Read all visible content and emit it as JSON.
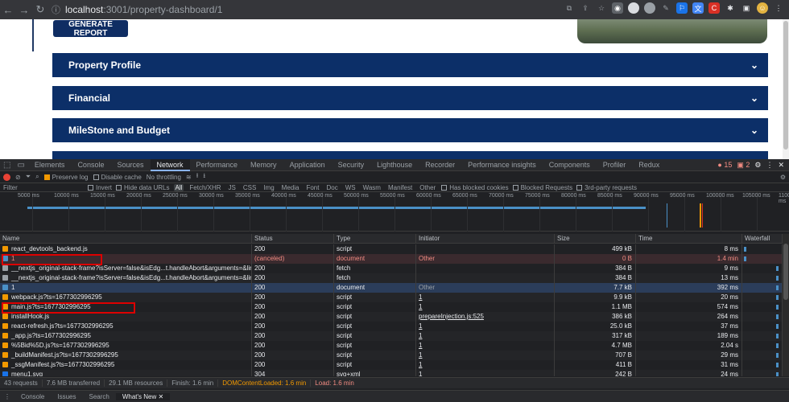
{
  "browser": {
    "url_host": "localhost",
    "url_path": ":3001/property-dashboard/1"
  },
  "page": {
    "generate_label": "GENERATE REPORT",
    "accordions": [
      {
        "label": "Property Profile"
      },
      {
        "label": "Financial"
      },
      {
        "label": "MileStone and Budget"
      }
    ]
  },
  "devtools": {
    "tabs": [
      "Elements",
      "Console",
      "Sources",
      "Network",
      "Performance",
      "Memory",
      "Application",
      "Security",
      "Lighthouse",
      "Recorder",
      "Performance insights",
      "Components",
      "Profiler",
      "Redux"
    ],
    "active_tab": "Network",
    "errors": "15",
    "warnings": "2",
    "toolbar": {
      "preserve_log": "Preserve log",
      "disable_cache": "Disable cache",
      "throttling": "No throttling"
    },
    "filter": {
      "placeholder": "Filter",
      "invert": "Invert",
      "hide_data_urls": "Hide data URLs",
      "types": [
        "All",
        "Fetch/XHR",
        "JS",
        "CSS",
        "Img",
        "Media",
        "Font",
        "Doc",
        "WS",
        "Wasm",
        "Manifest",
        "Other"
      ],
      "has_blocked_cookies": "Has blocked cookies",
      "blocked_requests": "Blocked Requests",
      "third_party": "3rd-party requests"
    },
    "timeline_ticks": [
      "5000 ms",
      "10000 ms",
      "15000 ms",
      "20000 ms",
      "25000 ms",
      "30000 ms",
      "35000 ms",
      "40000 ms",
      "45000 ms",
      "50000 ms",
      "55000 ms",
      "60000 ms",
      "65000 ms",
      "70000 ms",
      "75000 ms",
      "80000 ms",
      "85000 ms",
      "90000 ms",
      "95000 ms",
      "100000 ms",
      "105000 ms",
      "110000 ms"
    ],
    "columns": [
      "Name",
      "Status",
      "Type",
      "Initiator",
      "Size",
      "Time",
      "Waterfall"
    ],
    "rows": [
      {
        "name": "react_devtools_backend.js",
        "status": "200",
        "type": "script",
        "initiator": "",
        "size": "499 kB",
        "time": "8 ms",
        "kind": "script"
      },
      {
        "name": "1",
        "status": "(canceled)",
        "type": "document",
        "initiator": "Other",
        "size": "0 B",
        "time": "1.4 min",
        "kind": "doc",
        "canceled": true
      },
      {
        "name": "__nextjs_original-stack-frame?isServer=false&isEdg...t.handleAbort&arguments=&lineNumber=...",
        "status": "200",
        "type": "fetch",
        "initiator": "",
        "size": "384 B",
        "time": "9 ms",
        "kind": "fetch"
      },
      {
        "name": "__nextjs_original-stack-frame?isServer=false&isEdg...t.handleAbort&arguments=&lineNumber=...",
        "status": "200",
        "type": "fetch",
        "initiator": "",
        "size": "384 B",
        "time": "13 ms",
        "kind": "fetch"
      },
      {
        "name": "1",
        "status": "200",
        "type": "document",
        "initiator": "Other",
        "size": "7.7 kB",
        "time": "392 ms",
        "kind": "doc"
      },
      {
        "name": "webpack.js?ts=1677302996295",
        "status": "200",
        "type": "script",
        "initiator": "1",
        "size": "9.9 kB",
        "time": "20 ms",
        "kind": "script"
      },
      {
        "name": "main.js?ts=1677302996295",
        "status": "200",
        "type": "script",
        "initiator": "1",
        "size": "1.1 MB",
        "time": "574 ms",
        "kind": "script"
      },
      {
        "name": "installHook.js",
        "status": "200",
        "type": "script",
        "initiator": "prepareInjection.js:525",
        "size": "386 kB",
        "time": "264 ms",
        "kind": "script"
      },
      {
        "name": "react-refresh.js?ts=1677302996295",
        "status": "200",
        "type": "script",
        "initiator": "1",
        "size": "25.0 kB",
        "time": "37 ms",
        "kind": "script"
      },
      {
        "name": "_app.js?ts=1677302996295",
        "status": "200",
        "type": "script",
        "initiator": "1",
        "size": "317 kB",
        "time": "189 ms",
        "kind": "script"
      },
      {
        "name": "%5Bid%5D.js?ts=1677302996295",
        "status": "200",
        "type": "script",
        "initiator": "1",
        "size": "4.7 MB",
        "time": "2.04 s",
        "kind": "script"
      },
      {
        "name": "_buildManifest.js?ts=1677302996295",
        "status": "200",
        "type": "script",
        "initiator": "1",
        "size": "707 B",
        "time": "29 ms",
        "kind": "script"
      },
      {
        "name": "_ssgManifest.js?ts=1677302996295",
        "status": "200",
        "type": "script",
        "initiator": "1",
        "size": "411 B",
        "time": "31 ms",
        "kind": "script"
      },
      {
        "name": "menu1.svg",
        "status": "304",
        "type": "svg+xml",
        "initiator": "1",
        "size": "242 B",
        "time": "24 ms",
        "kind": "img"
      }
    ],
    "status_bar": {
      "requests": "43 requests",
      "transferred": "7.6 MB transferred",
      "resources": "29.1 MB resources",
      "finish": "Finish: 1.6 min",
      "dcl": "DOMContentLoaded: 1.6 min",
      "load": "Load: 1.6 min"
    },
    "drawer_tabs": [
      "Console",
      "Issues",
      "Search",
      "What's New"
    ],
    "drawer_active": "What's New"
  }
}
